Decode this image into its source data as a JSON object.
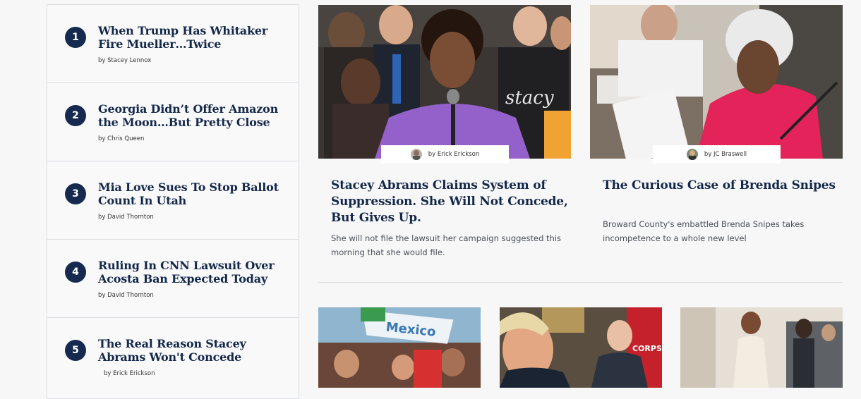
{
  "trending": [
    {
      "number": "1",
      "title": "When Trump Has Whitaker Fire Mueller…Twice",
      "author": "by Stacey Lennox"
    },
    {
      "number": "2",
      "title": "Georgia Didn’t Offer Amazon the Moon…But Pretty Close",
      "author": "by Chris Queen"
    },
    {
      "number": "3",
      "title": "Mia Love Sues To Stop Ballot Count In Utah",
      "author": "by David Thornton"
    },
    {
      "number": "4",
      "title": "Ruling In CNN Lawsuit Over Acosta Ban Expected Today",
      "author": "by David Thornton"
    },
    {
      "number": "5",
      "title": "The Real Reason Stacey Abrams Won't Concede",
      "author": "by Erick Erickson"
    }
  ],
  "features": [
    {
      "author": "by Erick Erickson",
      "title": "Stacey Abrams Claims System of Suppression. She Will Not Concede, But Gives Up.",
      "description": "She will not file the lawsuit her campaign suggested this morning that she would file."
    },
    {
      "author": "by JC Braswell",
      "title": "The Curious Case of Brenda Snipes",
      "description": "Broward County's embattled Brenda Snipes takes incompetence to a whole new level"
    }
  ],
  "photo_sign_text": "Mexico",
  "photo_sign_text_2": "CORPS"
}
